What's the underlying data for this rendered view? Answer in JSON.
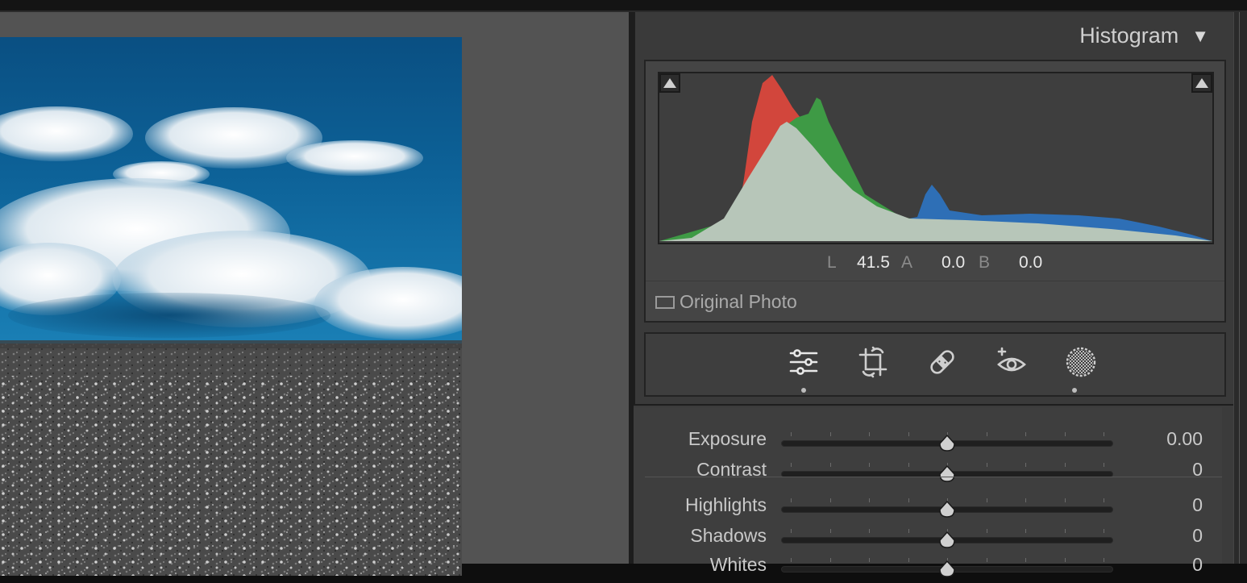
{
  "histogram": {
    "title": "Histogram",
    "lab": {
      "l_key": "L",
      "l_value": "41.5",
      "a_key": "A",
      "a_value": "0.0",
      "b_key": "B",
      "b_value": "0.0"
    },
    "original_photo_label": "Original Photo"
  },
  "tools": [
    "edit-sliders-icon",
    "crop-icon",
    "healing-bandage-icon",
    "red-eye-icon",
    "masking-icon"
  ],
  "sliders": [
    {
      "label": "Exposure",
      "value": "0.00",
      "position": 0.5
    },
    {
      "label": "Contrast",
      "value": "0",
      "position": 0.5
    },
    {
      "label": "Highlights",
      "value": "0",
      "position": 0.5
    },
    {
      "label": "Shadows",
      "value": "0",
      "position": 0.5
    },
    {
      "label": "Whites",
      "value": "0",
      "position": 0.5
    }
  ],
  "colors": {
    "hist_red": "#d2463c",
    "hist_green": "#3e9a45",
    "hist_blue": "#2e6fb6",
    "hist_luma": "#b7c6b9",
    "sky": "#0e5e94"
  }
}
